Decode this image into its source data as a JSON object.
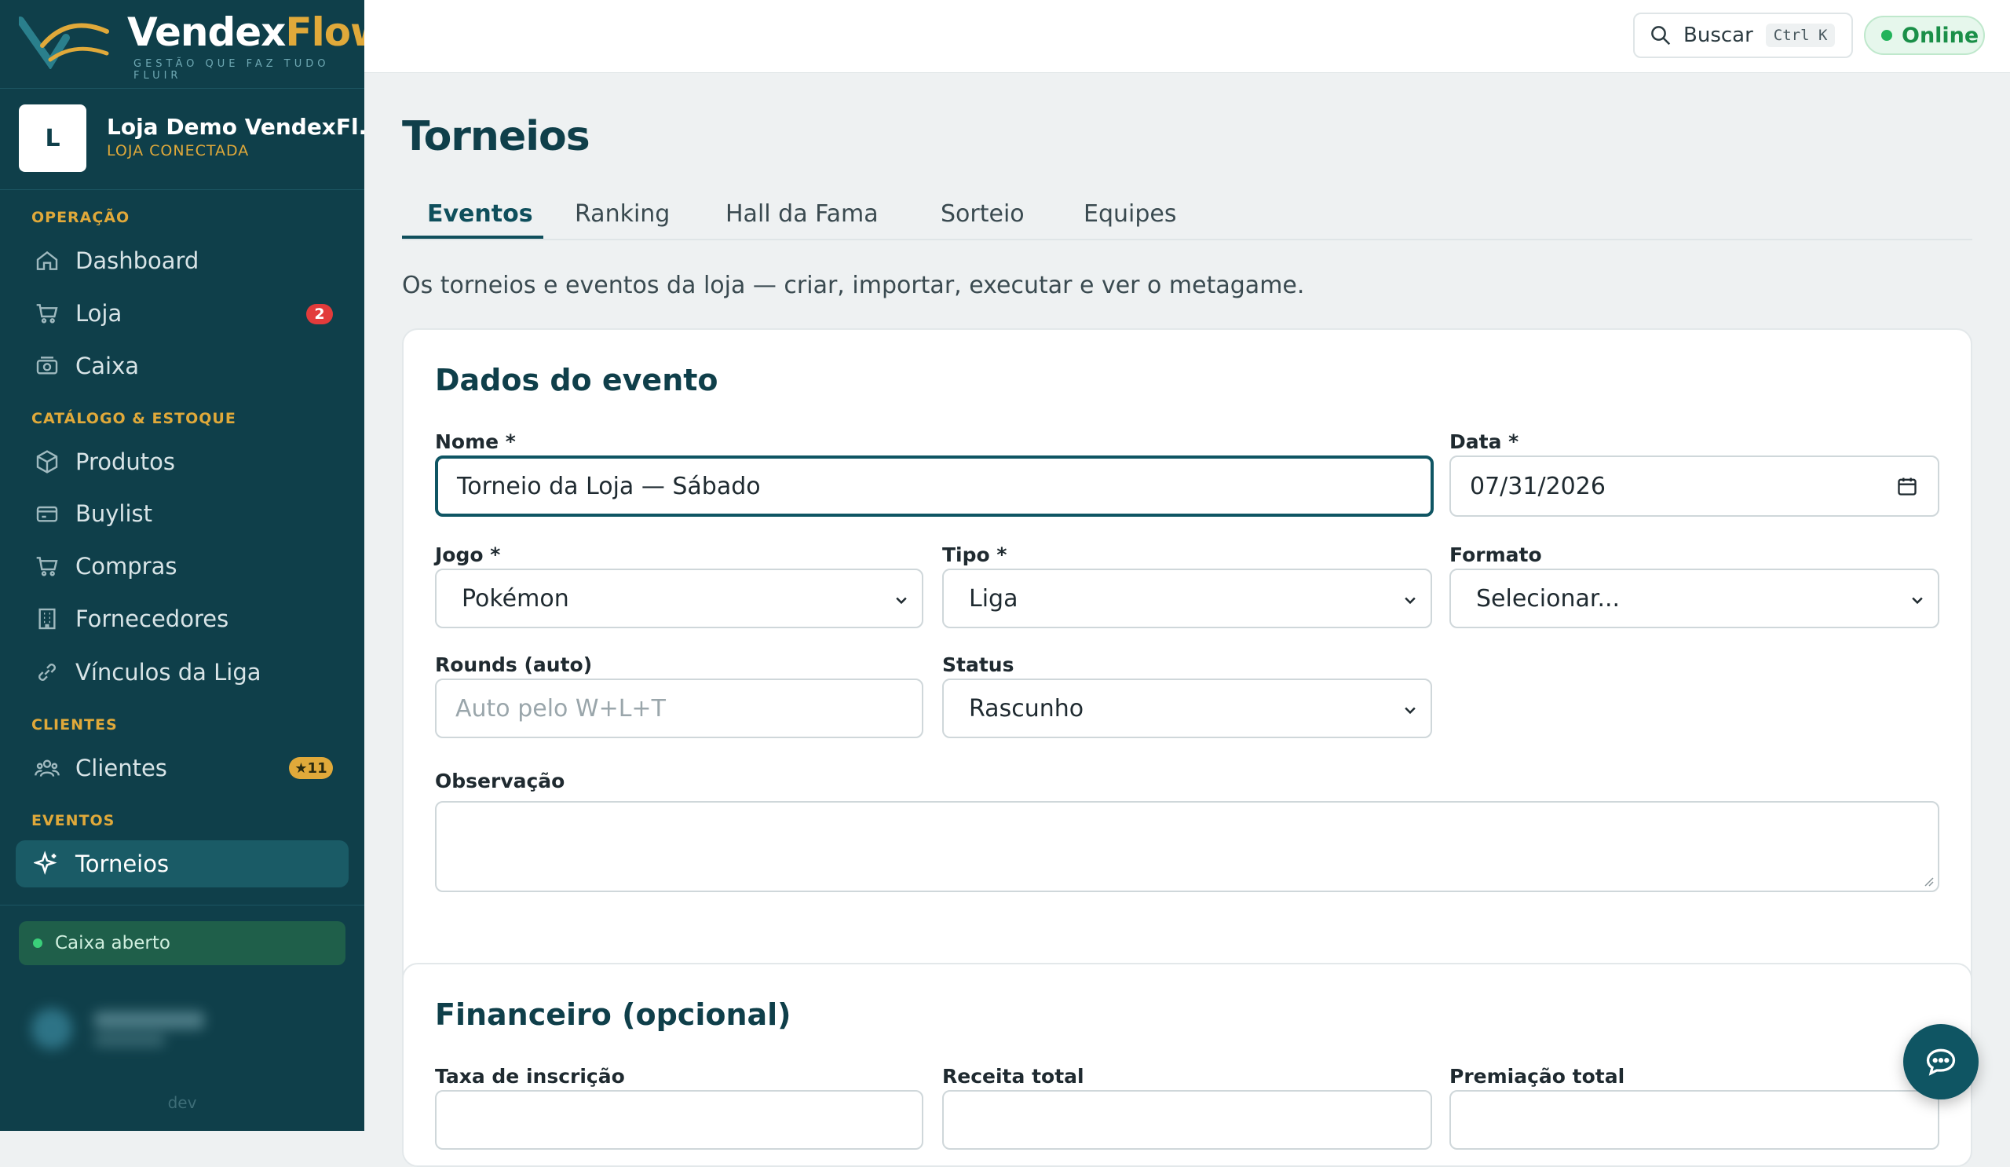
{
  "brand": {
    "name_main": "Vendex",
    "name_accent": "Flow",
    "tagline": "GESTÃO QUE FAZ TUDO FLUIR"
  },
  "store": {
    "initial": "L",
    "name": "Loja Demo VendexFl...",
    "status": "LOJA CONECTADA"
  },
  "sidebar": {
    "sections": [
      {
        "title": "OPERAÇÃO"
      },
      {
        "title": "CATÁLOGO & ESTOQUE"
      },
      {
        "title": "CLIENTES"
      },
      {
        "title": "EVENTOS"
      }
    ],
    "items": [
      {
        "label": "Dashboard",
        "icon": "home-icon"
      },
      {
        "label": "Loja",
        "icon": "cart-icon",
        "badge": "2"
      },
      {
        "label": "Caixa",
        "icon": "cash-register-icon"
      },
      {
        "label": "Produtos",
        "icon": "box-icon"
      },
      {
        "label": "Buylist",
        "icon": "wallet-icon"
      },
      {
        "label": "Compras",
        "icon": "cart-icon"
      },
      {
        "label": "Fornecedores",
        "icon": "building-icon"
      },
      {
        "label": "Vínculos da Liga",
        "icon": "link-icon"
      },
      {
        "label": "Clientes",
        "icon": "users-icon",
        "badge": "★11"
      },
      {
        "label": "Torneios",
        "icon": "sparkle-icon",
        "active": true
      }
    ],
    "cash_status": "Caixa aberto",
    "env": "dev"
  },
  "topbar": {
    "search_label": "Buscar",
    "shortcut": "Ctrl K",
    "status": "Online"
  },
  "main": {
    "title": "Torneios",
    "tabs": [
      "Eventos",
      "Ranking",
      "Hall da Fama",
      "Sorteio",
      "Equipes"
    ],
    "active_tab": "Eventos",
    "description": "Os torneios e eventos da loja — criar, importar, executar e ver o metagame.",
    "event_card": {
      "title": "Dados do evento",
      "nome_label": "Nome *",
      "nome_value": "Torneio da Loja — Sábado",
      "data_label": "Data *",
      "data_value": "07/31/2026",
      "jogo_label": "Jogo *",
      "jogo_value": "Pokémon",
      "tipo_label": "Tipo *",
      "tipo_value": "Liga",
      "formato_label": "Formato",
      "formato_value": "Selecionar...",
      "rounds_label": "Rounds (auto)",
      "rounds_placeholder": "Auto pelo W+L+T",
      "status_label": "Status",
      "status_value": "Rascunho",
      "obs_label": "Observação"
    },
    "finance_card": {
      "title": "Financeiro (opcional)",
      "taxa_label": "Taxa de inscrição",
      "receita_label": "Receita total",
      "premiacao_label": "Premiação total"
    }
  },
  "colors": {
    "sidebar": "#0f3f4a",
    "accent": "#e0a93a",
    "primary": "#0f5563",
    "online": "#22b35a",
    "badge": "#e23b3b"
  }
}
